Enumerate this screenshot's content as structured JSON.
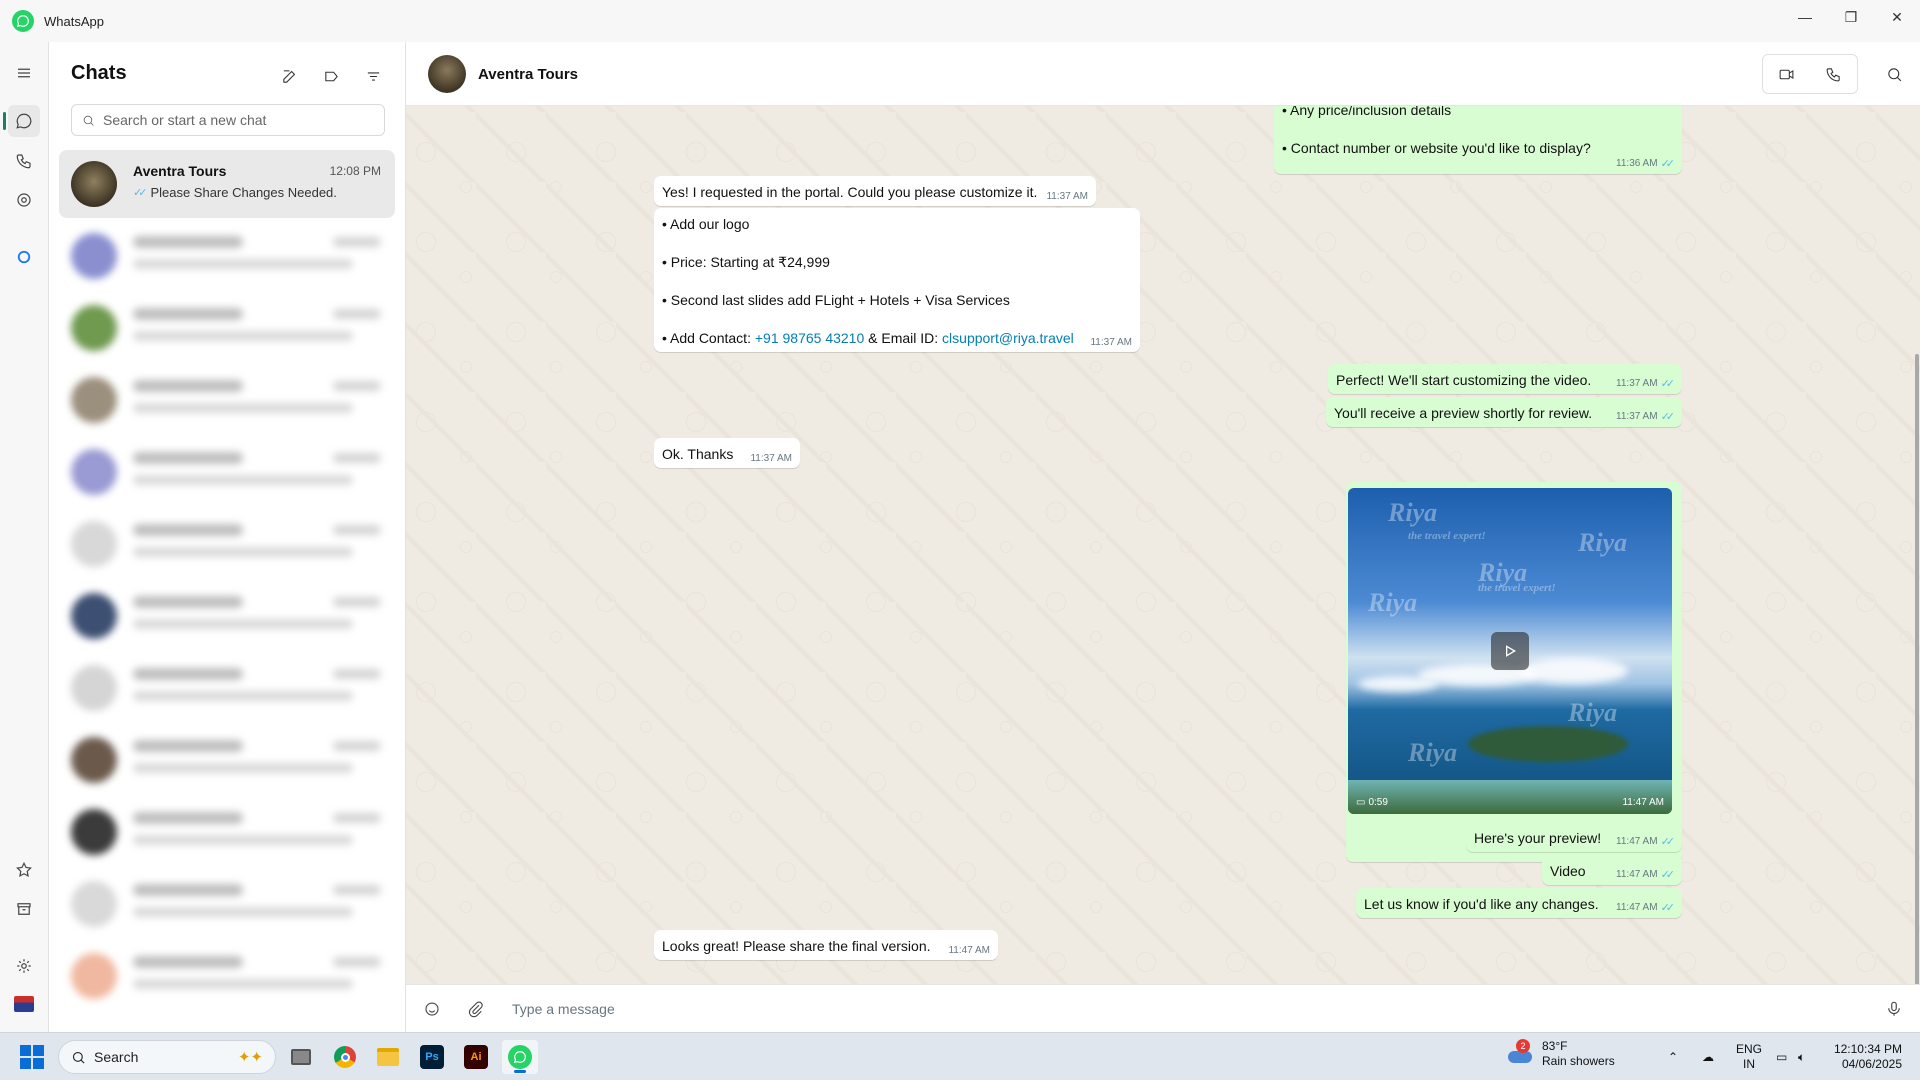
{
  "window": {
    "title": "WhatsApp"
  },
  "window_controls": {
    "minimize": "—",
    "maximize": "❐",
    "close": "✕"
  },
  "sidebar": {
    "heading": "Chats",
    "search_placeholder": "Search or start a new chat"
  },
  "chats": [
    {
      "name": "Aventra Tours",
      "time": "12:08 PM",
      "preview": "Please Share Changes Needed.",
      "selected": true,
      "read_ticks": "✓✓"
    }
  ],
  "conversation": {
    "contact_name": "Aventra Tours",
    "composer_placeholder": "Type a message",
    "messages": [
      {
        "direction": "out",
        "text": "• Any price/inclusion details",
        "time": ""
      },
      {
        "direction": "out",
        "text": "• Contact number or website you'd like to display?",
        "time": "11:36 AM",
        "ticks": "✓✓"
      },
      {
        "direction": "in",
        "text": "Yes! I requested in the portal. Could you please customize it.",
        "time": "11:37 AM"
      },
      {
        "direction": "in",
        "lines": [
          "• Add our logo",
          "• Price: Starting at ₹24,999",
          "• Second last slides add FLight + Hotels + Visa Services"
        ],
        "contact_prefix": "• Add Contact: ",
        "contact_phone": "+91 98765 43210",
        "contact_mid": " & Email ID: ",
        "contact_email": "clsupport@riya.travel",
        "time": "11:37 AM"
      },
      {
        "direction": "out",
        "text": "Perfect! We'll start customizing the video.",
        "time": "11:37 AM",
        "ticks": "✓✓"
      },
      {
        "direction": "out",
        "text": "You'll receive a preview shortly for review.",
        "time": "11:37 AM",
        "ticks": "✓✓"
      },
      {
        "direction": "in",
        "text": "Ok. Thanks",
        "time": "11:37 AM"
      },
      {
        "direction": "out",
        "type": "video",
        "duration": "0:59",
        "time": "11:47 AM",
        "watermark": "Riya",
        "watermark_tag": "the travel expert!"
      },
      {
        "direction": "out",
        "text": "Here's your preview!",
        "time": "11:47 AM",
        "ticks": "✓✓"
      },
      {
        "direction": "out",
        "text": "Video",
        "time": "11:47 AM",
        "ticks": "✓✓"
      },
      {
        "direction": "out",
        "text": "Let us know if you'd like any changes.",
        "time": "11:47 AM",
        "ticks": "✓✓"
      },
      {
        "direction": "in",
        "text": "Looks great! Please share the final version.",
        "time": "11:47 AM"
      }
    ]
  },
  "taskbar": {
    "search_label": "Search",
    "apps": [
      "Ps",
      "Ai"
    ],
    "weather_badge": "2",
    "weather_temp": "83°F",
    "weather_desc": "Rain showers",
    "lang_1": "ENG",
    "lang_2": "IN",
    "time": "12:10:34 PM",
    "date": "04/06/2025"
  },
  "colors": {
    "accent": "#25D366",
    "outgoing": "#d9fdd3",
    "chat_bg": "#efeae2",
    "tick_blue": "#53bdeb",
    "link": "#027eb5"
  }
}
